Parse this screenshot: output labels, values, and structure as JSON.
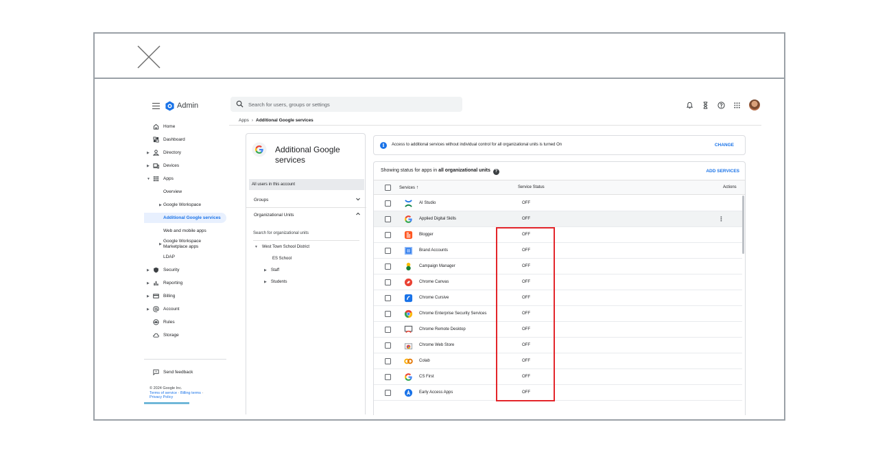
{
  "header": {
    "product": "Admin",
    "search_placeholder": "Search for users, groups or settings"
  },
  "breadcrumb": {
    "root": "Apps",
    "current": "Additional Google services"
  },
  "nav": {
    "items": [
      {
        "label": "Home",
        "icon": "home-icon"
      },
      {
        "label": "Dashboard",
        "icon": "dashboard-icon"
      },
      {
        "label": "Directory",
        "icon": "person-icon"
      },
      {
        "label": "Devices",
        "icon": "devices-icon"
      },
      {
        "label": "Apps",
        "icon": "apps-grid-icon"
      },
      {
        "label": "Overview"
      },
      {
        "label": "Google Workspace"
      },
      {
        "label": "Additional Google services"
      },
      {
        "label": "Web and mobile apps"
      },
      {
        "label": "Google Workspace Marketplace apps"
      },
      {
        "label": "LDAP"
      },
      {
        "label": "Security",
        "icon": "shield-icon"
      },
      {
        "label": "Reporting",
        "icon": "bar-chart-icon"
      },
      {
        "label": "Billing",
        "icon": "credit-card-icon"
      },
      {
        "label": "Account",
        "icon": "at-icon"
      },
      {
        "label": "Rules",
        "icon": "rules-icon"
      },
      {
        "label": "Storage",
        "icon": "cloud-icon"
      }
    ],
    "feedback": "Send feedback",
    "footer": {
      "copyright": "© 2024 Google Inc.",
      "terms": "Terms of service",
      "billing_terms": "Billing terms",
      "privacy": "Privacy Policy"
    }
  },
  "middle": {
    "title": "Additional Google services",
    "all_users": "All users in this account",
    "groups": "Groups",
    "org_units": "Organizational Units",
    "search_ou": "Search for organizational units",
    "tree": [
      "West Town School District",
      "ES School",
      "Staff",
      "Students"
    ]
  },
  "banner": {
    "message": "Access to additional services without individual control for all organizational units is turned On",
    "action": "CHANGE"
  },
  "table": {
    "status_prefix": "Showing status for apps in",
    "status_scope": "all organizational units",
    "add_services": "ADD SERVICES",
    "col_services": "Services",
    "col_status": "Service Status",
    "col_actions": "Actions",
    "rows": [
      {
        "name": "AI Studio",
        "status": "OFF",
        "icon": "ai-studio-icon"
      },
      {
        "name": "Applied Digital Skills",
        "status": "OFF",
        "icon": "google-g-icon"
      },
      {
        "name": "Blogger",
        "status": "OFF",
        "icon": "blogger-icon"
      },
      {
        "name": "Brand Accounts",
        "status": "OFF",
        "icon": "brand-accounts-icon"
      },
      {
        "name": "Campaign Manager",
        "status": "OFF",
        "icon": "campaign-manager-icon"
      },
      {
        "name": "Chrome Canvas",
        "status": "OFF",
        "icon": "chrome-canvas-icon"
      },
      {
        "name": "Chrome Cursive",
        "status": "OFF",
        "icon": "chrome-cursive-icon"
      },
      {
        "name": "Chrome Enterprise Security Services",
        "status": "OFF",
        "icon": "chrome-icon"
      },
      {
        "name": "Chrome Remote Desktop",
        "status": "OFF",
        "icon": "remote-desktop-icon"
      },
      {
        "name": "Chrome Web Store",
        "status": "OFF",
        "icon": "web-store-icon"
      },
      {
        "name": "Colab",
        "status": "OFF",
        "icon": "colab-icon"
      },
      {
        "name": "CS First",
        "status": "OFF",
        "icon": "google-g-icon"
      },
      {
        "name": "Early Access Apps",
        "status": "OFF",
        "icon": "early-access-icon"
      }
    ]
  }
}
